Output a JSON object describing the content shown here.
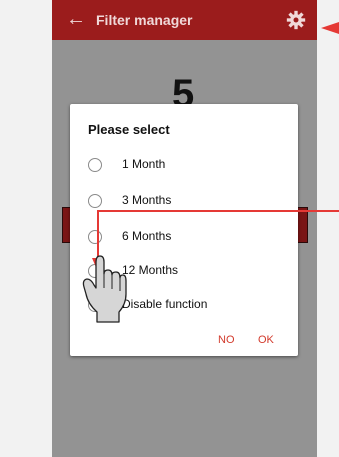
{
  "appbar": {
    "title": "Filter manager",
    "back_icon": "arrow-left-icon",
    "settings_icon": "gear-icon"
  },
  "counter": {
    "value": "5"
  },
  "dialog": {
    "title": "Please select",
    "options": [
      {
        "label": "1 Month"
      },
      {
        "label": "3 Months"
      },
      {
        "label": "6 Months"
      },
      {
        "label": "12 Months"
      },
      {
        "label": "Disable function"
      }
    ],
    "no_label": "NO",
    "ok_label": "OK"
  },
  "colors": {
    "appbar": "#9b1c1c",
    "callout": "#e53935",
    "dialog_buttons": "#d23a2c"
  }
}
